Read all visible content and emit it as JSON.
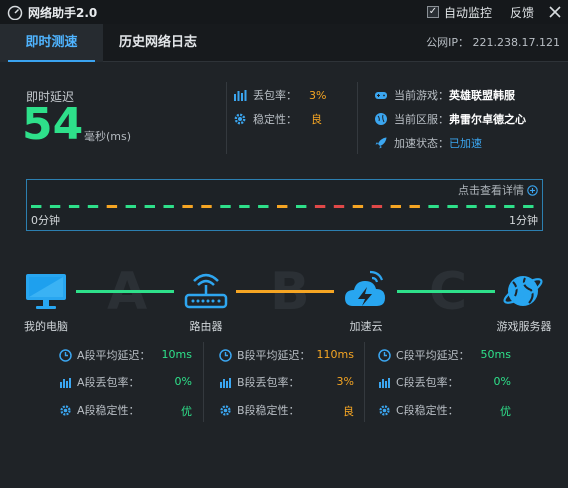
{
  "window": {
    "title": "网络助手2.0",
    "auto_monitor_label": "自动监控",
    "auto_monitor_checked": true,
    "feedback_label": "反馈"
  },
  "tabs": [
    {
      "label": "即时测速",
      "active": true
    },
    {
      "label": "历史网络日志",
      "active": false
    }
  ],
  "public_ip": "公网IP： 221.238.17.121",
  "latency": {
    "label": "即时延迟",
    "value": "54",
    "unit": "毫秒(ms)"
  },
  "metrics": {
    "loss_label": "丢包率：",
    "loss_value": "3%",
    "stability_label": "稳定性：",
    "stability_value": "良"
  },
  "game_info": {
    "game_label": "当前游戏：",
    "game_value": "英雄联盟韩服",
    "region_label": "当前区服：",
    "region_value": "弗雷尔卓德之心",
    "accel_label": "加速状态：",
    "accel_value": "已加速"
  },
  "graph": {
    "detail_label": "点击查看详情",
    "start_label": "0分钟",
    "end_label": "1分钟",
    "dash_colors": [
      "#2ee08a",
      "#2ee08a",
      "#2ee08a",
      "#2ee08a",
      "#f5a523",
      "#2ee08a",
      "#2ee08a",
      "#2ee08a",
      "#f5a523",
      "#f5a523",
      "#2ee08a",
      "#2ee08a",
      "#2ee08a",
      "#f5a523",
      "#2ee08a",
      "#e04848",
      "#e04848",
      "#f5a523",
      "#e04848",
      "#f5a523",
      "#f5a523",
      "#2ee08a",
      "#2ee08a",
      "#2ee08a",
      "#2ee08a",
      "#2ee08a",
      "#2ee08a"
    ]
  },
  "route": {
    "letters": [
      "A",
      "B",
      "C"
    ],
    "nodes": [
      "我的电脑",
      "路由器",
      "加速云",
      "游戏服务器"
    ],
    "line_colors": [
      "#2ee08a",
      "#f5a523",
      "#2ee08a"
    ]
  },
  "segments": [
    {
      "latency_label": "A段平均延迟：",
      "latency_value": "10ms",
      "loss_label": "A段丢包率：",
      "loss_value": "0%",
      "stability_label": "A段稳定性：",
      "stability_value": "优"
    },
    {
      "latency_label": "B段平均延迟：",
      "latency_value": "110ms",
      "loss_label": "B段丢包率：",
      "loss_value": "3%",
      "stability_label": "B段稳定性：",
      "stability_value": "良"
    },
    {
      "latency_label": "C段平均延迟：",
      "latency_value": "50ms",
      "loss_label": "C段丢包率：",
      "loss_value": "0%",
      "stability_label": "C段稳定性：",
      "stability_value": "优"
    }
  ]
}
